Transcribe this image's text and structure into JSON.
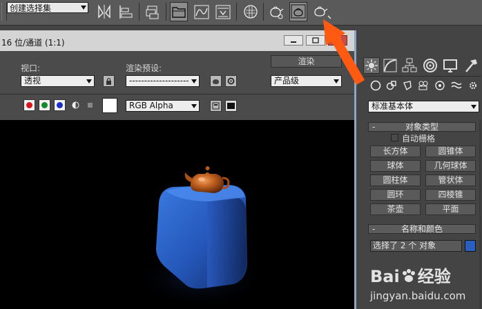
{
  "toolbar": {
    "selection_set_combo": "创建选择集",
    "icons": [
      "mirror-icon",
      "align-icon",
      "layer-manager-icon",
      "scene-explorer-icon",
      "curve-editor-icon",
      "schematic-view-icon",
      "material-editor-icon",
      "render-setup-icon",
      "rendered-frame-window-icon",
      "render-production-icon"
    ]
  },
  "render_window": {
    "title": "16 位/通道 (1:1)",
    "viewport_label": "视口:",
    "viewport_value": "透视",
    "preset_label": "渲染预设:",
    "preset_value": "--------------------",
    "render_button": "渲染",
    "quality_value": "产品级",
    "channel_value": "RGB Alpha"
  },
  "command_panel": {
    "category_dropdown": "标准基本体",
    "object_type": {
      "header": "对象类型",
      "autogrid_label": "自动栅格",
      "buttons": [
        "长方体",
        "圆锥体",
        "球体",
        "几何球体",
        "圆柱体",
        "管状体",
        "圆环",
        "四棱锥",
        "茶壶",
        "平面"
      ]
    },
    "name_color": {
      "header": "名称和颜色",
      "name_value": "选择了 2 个 对象",
      "color": "#2a5fbf"
    }
  },
  "colors": {
    "arrow": "#ff5a12",
    "box": "#2a5fc5",
    "teapot": "#b5581a"
  },
  "watermark": {
    "brand_a": "Bai",
    "brand_b": "经验",
    "url": "jingyan.baidu.com"
  }
}
